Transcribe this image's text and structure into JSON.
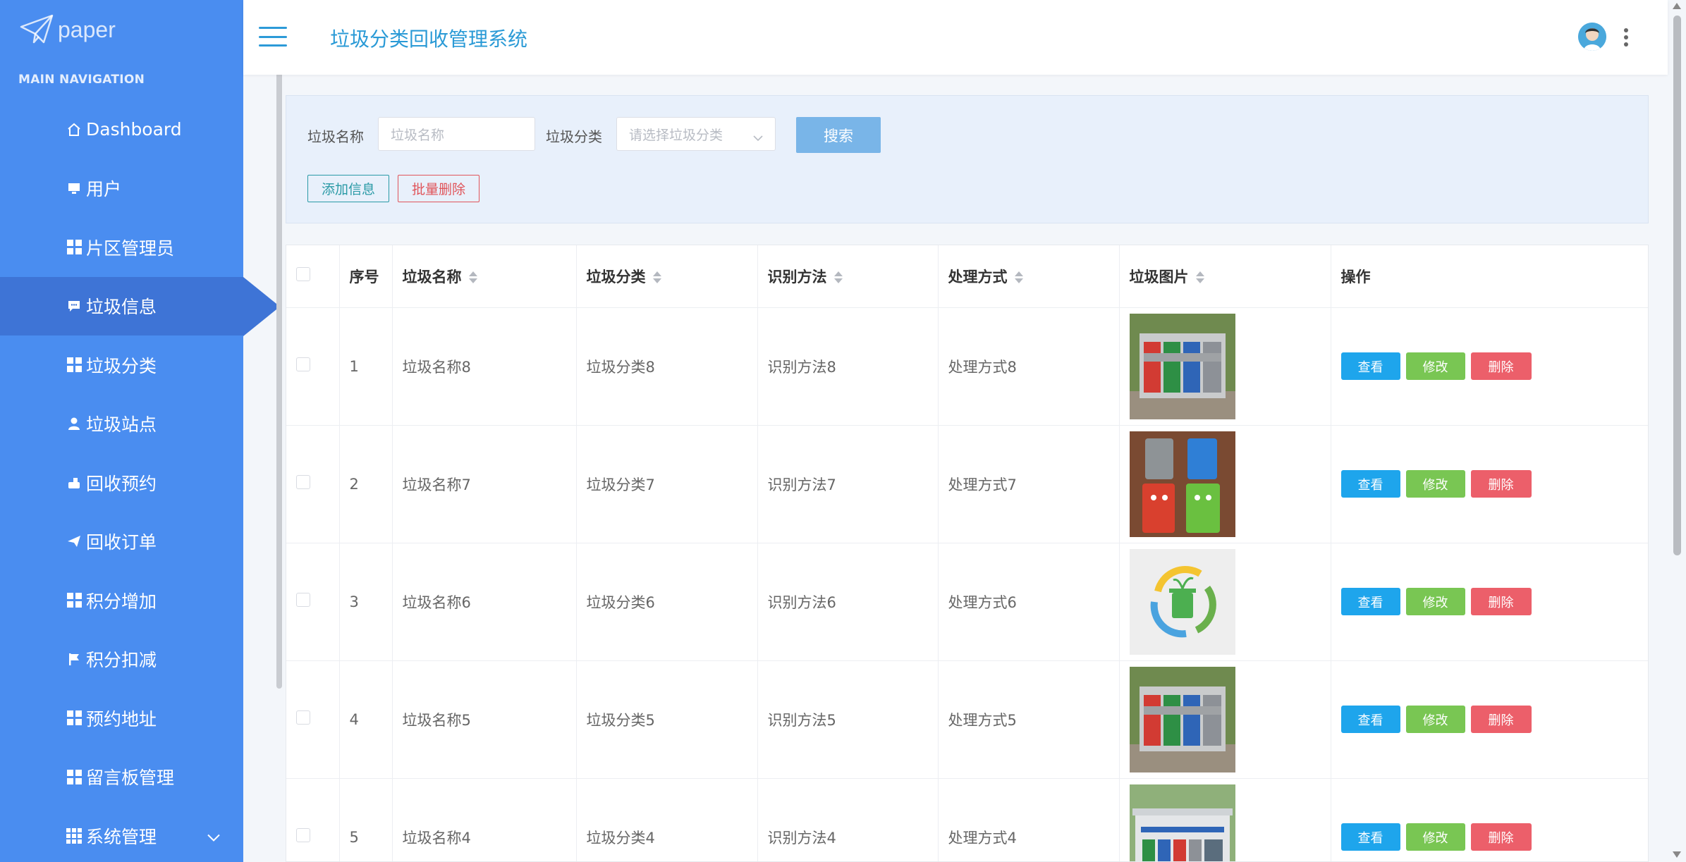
{
  "brand": {
    "logo_text": "paper"
  },
  "sidebar": {
    "section_title": "MAIN NAVIGATION",
    "items": [
      {
        "label": "Dashboard",
        "icon": "home-icon"
      },
      {
        "label": "用户",
        "icon": "monitor-icon"
      },
      {
        "label": "片区管理员",
        "icon": "grid-icon"
      },
      {
        "label": "垃圾信息",
        "icon": "comment-icon",
        "active": true
      },
      {
        "label": "垃圾分类",
        "icon": "grid-icon"
      },
      {
        "label": "垃圾站点",
        "icon": "user-icon"
      },
      {
        "label": "回收预约",
        "icon": "hand-icon"
      },
      {
        "label": "回收订单",
        "icon": "send-icon"
      },
      {
        "label": "积分增加",
        "icon": "grid-icon"
      },
      {
        "label": "积分扣减",
        "icon": "flag-icon"
      },
      {
        "label": "预约地址",
        "icon": "grid-icon"
      },
      {
        "label": "留言板管理",
        "icon": "grid-icon"
      },
      {
        "label": "系统管理",
        "icon": "grid9-icon",
        "has_children": true
      }
    ]
  },
  "header": {
    "title": "垃圾分类回收管理系统"
  },
  "search": {
    "name_label": "垃圾名称",
    "name_placeholder": "垃圾名称",
    "category_label": "垃圾分类",
    "category_placeholder": "请选择垃圾分类",
    "search_button": "搜索",
    "add_button": "添加信息",
    "batch_delete_button": "批量删除"
  },
  "table": {
    "headers": [
      "序号",
      "垃圾名称",
      "垃圾分类",
      "识别方法",
      "处理方式",
      "垃圾图片",
      "操作"
    ],
    "rows": [
      {
        "index": "1",
        "name": "垃圾名称8",
        "category": "垃圾分类8",
        "method": "识别方法8",
        "process": "处理方式8",
        "image": "cabinet"
      },
      {
        "index": "2",
        "name": "垃圾名称7",
        "category": "垃圾分类7",
        "method": "识别方法7",
        "process": "处理方式7",
        "image": "bins"
      },
      {
        "index": "3",
        "name": "垃圾名称6",
        "category": "垃圾分类6",
        "method": "识别方法6",
        "process": "处理方式6",
        "image": "recycle"
      },
      {
        "index": "4",
        "name": "垃圾名称5",
        "category": "垃圾分类5",
        "method": "识别方法5",
        "process": "处理方式5",
        "image": "cabinet"
      },
      {
        "index": "5",
        "name": "垃圾名称4",
        "category": "垃圾分类4",
        "method": "识别方法4",
        "process": "处理方式4",
        "image": "station"
      }
    ],
    "actions": {
      "view": "查看",
      "edit": "修改",
      "delete": "删除"
    }
  },
  "colors": {
    "sidebar": "#4a8df0",
    "sidebar_active": "#3e74d6",
    "title": "#2a9ad6",
    "view": "#1ea5ec",
    "edit": "#79c653",
    "delete": "#ec5f6a"
  }
}
